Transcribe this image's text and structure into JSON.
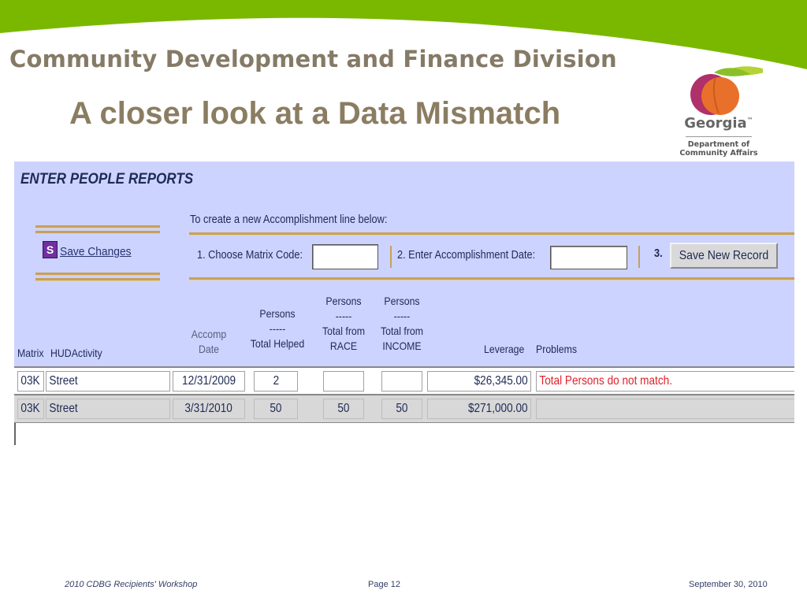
{
  "slide": {
    "division": "Community Development and Finance Division",
    "title": "A closer look at a Data Mismatch",
    "logo": {
      "state": "Georgia",
      "trademark": "™",
      "dept_line1": "Department of",
      "dept_line2": "Community Affairs"
    }
  },
  "form": {
    "title": "ENTER PEOPLE REPORTS",
    "save_icon_letter": "S",
    "save_label": "Save Changes",
    "instruction": "To create a new Accomplishment line below:",
    "step1_label": "1. Choose Matrix Code:",
    "step1_value": "",
    "step2_label": "2. Enter Accomplishment Date:",
    "step2_value": "",
    "step3_label": "3.",
    "save_new_label": "Save New Record",
    "columns": {
      "matrix": "Matrix",
      "activity": "HUDActivity",
      "accomp_l1": "Accomp",
      "accomp_l2": "Date",
      "helped_l1": "Persons",
      "helped_l2": "-----",
      "helped_l3": "Total Helped",
      "race_l1": "Persons",
      "race_l2": "-----",
      "race_l3": "Total from",
      "race_l4": "RACE",
      "income_l1": "Persons",
      "income_l2": "-----",
      "income_l3": "Total from",
      "income_l4": "INCOME",
      "leverage": "Leverage",
      "problems": "Problems"
    },
    "rows": [
      {
        "matrix": "03K",
        "activity": "Street",
        "date": "12/31/2009",
        "helped": "2",
        "race": "",
        "income": "",
        "leverage": "$26,345.00",
        "problem": "Total Persons do not match."
      },
      {
        "matrix": "03K",
        "activity": "Street",
        "date": "3/31/2010",
        "helped": "50",
        "race": "50",
        "income": "50",
        "leverage": "$271,000.00",
        "problem": ""
      }
    ]
  },
  "footer": {
    "left": "2010 CDBG Recipients' Workshop",
    "center": "Page 12",
    "right": "September 30, 2010"
  },
  "colors": {
    "accent_green": "#7ab800",
    "title_brown": "#8b7d62",
    "panel_blue": "#ccd3ff",
    "peach": "#e8702a",
    "gold_rule": "#c8a05a"
  }
}
